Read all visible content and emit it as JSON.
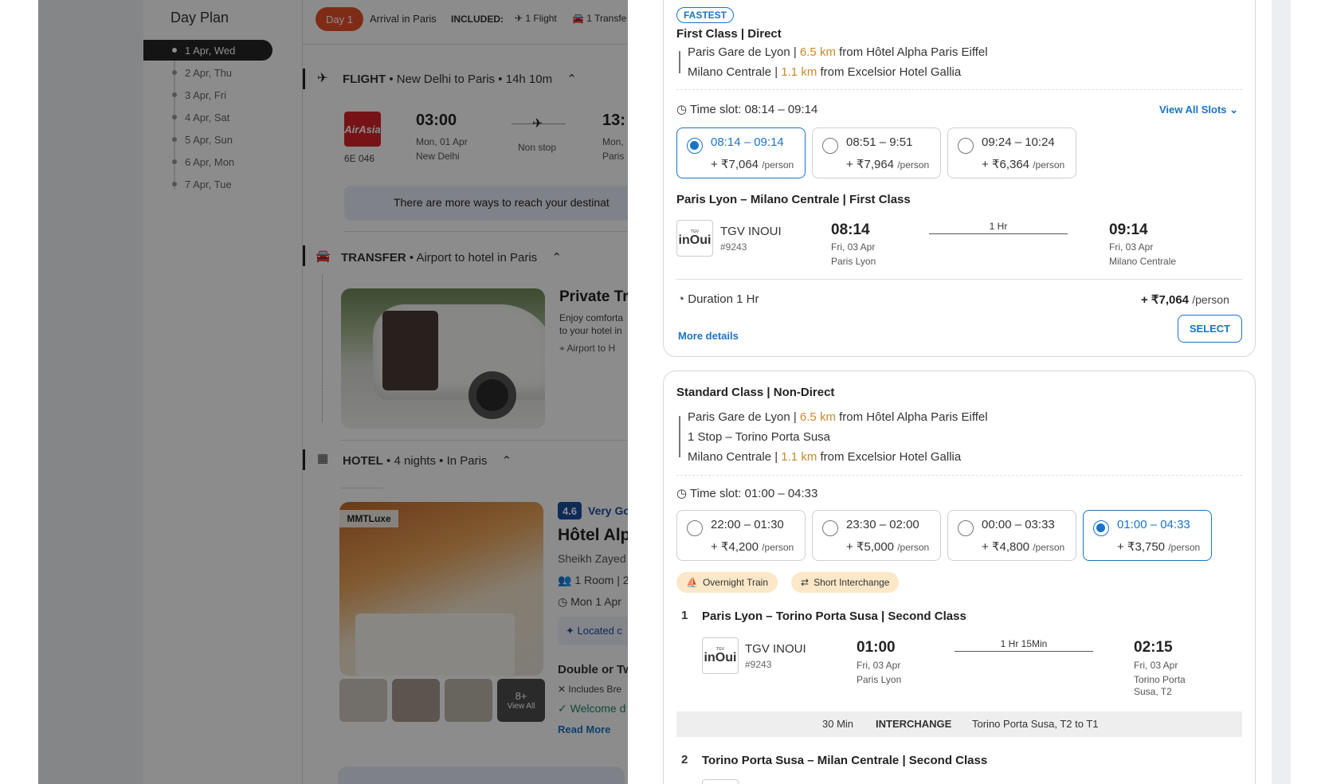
{
  "left": {
    "dayplan_title": "Day Plan",
    "days": [
      "1 Apr, Wed",
      "2 Apr, Thu",
      "3 Apr, Fri",
      "4 Apr, Sat",
      "5 Apr, Sun",
      "6 Apr, Mon",
      "7 Apr, Tue"
    ],
    "day_badge": "Day 1",
    "arrival": "Arrival in Paris",
    "included_label": "INCLUDED:",
    "included_flight": "1 Flight",
    "included_transfer": "1 Transfe",
    "flight": {
      "title": "FLIGHT",
      "route": "New Delhi to Paris",
      "duration": "14h 10m",
      "airline_logo": "AirAsia",
      "code": "6E 046",
      "dep_time": "03:00",
      "dep_date": "Mon, 01 Apr",
      "dep_city": "New Delhi",
      "stops": "Non stop",
      "arr_time": "13:",
      "arr_date": "Mon,",
      "arr_city": "Paris",
      "banner": "There are more ways to reach your destinat"
    },
    "transfer": {
      "title": "TRANSFER",
      "route": "Airport to hotel in Paris",
      "name": "Private Tra",
      "desc1": "Enjoy comforta",
      "desc2": "to your hotel in",
      "loc": "Airport to H"
    },
    "hotel": {
      "title": "HOTEL",
      "nights": "4 nights",
      "place": "In Paris",
      "badge": "MMTLuxe",
      "rating": "4.6",
      "rating_text": "Very Go",
      "name": "Hôtel Alp",
      "address": "Sheikh Zayed",
      "rooms": "1 Room | 2",
      "dates": "Mon 1 Apr",
      "located": "Located c",
      "room_type": "Double or Tw",
      "includes": "Includes Bre",
      "welcome": "Welcome d",
      "read_more": "Read More",
      "view_more_count": "8+",
      "view_all": "View All"
    }
  },
  "option1": {
    "badge": "FASTEST",
    "class": "First Class | Direct",
    "from_station": "Paris Gare de Lyon |",
    "from_dist": "6.5 km",
    "from_hotel": "from Hôtel Alpha Paris Eiffel",
    "to_station": "Milano Centrale |",
    "to_dist": "1.1 km",
    "to_hotel": "from Excelsior Hotel Gallia",
    "timeslot": "Time slot: 08:14 – 09:14",
    "view_all": "View All Slots",
    "slots": [
      {
        "time": "08:14 – 09:14",
        "price": "+ ₹7,064",
        "per": "/person"
      },
      {
        "time": "08:51 – 9:51",
        "price": "+ ₹7,964",
        "per": "/person"
      },
      {
        "time": "09:24 – 10:24",
        "price": "+ ₹6,364",
        "per": "/person"
      }
    ],
    "segment_title": "Paris Lyon – Milano Centrale | First Class",
    "train_name": "TGV INOUI",
    "train_no": "#9243",
    "dep_time": "08:14",
    "dep_date": "Fri, 03 Apr",
    "dep_station": "Paris Lyon",
    "duration_mid": "1 Hr",
    "arr_time": "09:14",
    "arr_date": "Fri, 03 Apr",
    "arr_station": "Milano Centrale",
    "duration": "Duration 1 Hr",
    "price": "+ ₹7,064",
    "per": "/person",
    "more": "More details",
    "select": "SELECT"
  },
  "option2": {
    "class": "Standard Class | Non-Direct",
    "from_station": "Paris Gare de Lyon |",
    "from_dist": "6.5 km",
    "from_hotel": "from Hôtel Alpha Paris Eiffel",
    "stop": "1 Stop – Torino Porta Susa",
    "to_station": "Milano Centrale |",
    "to_dist": "1.1 km",
    "to_hotel": "from Excelsior Hotel Gallia",
    "timeslot": "Time slot: 01:00 – 04:33",
    "slots": [
      {
        "time": "22:00 – 01:30",
        "price": "+ ₹4,200",
        "per": "/person"
      },
      {
        "time": "23:30 – 02:00",
        "price": "+ ₹5,000",
        "per": "/person"
      },
      {
        "time": "00:00 – 03:33",
        "price": "+ ₹4,800",
        "per": "/person"
      },
      {
        "time": "01:00 – 04:33",
        "price": "+ ₹3,750",
        "per": "/person"
      }
    ],
    "tag1": "Overnight Train",
    "tag2": "Short Interchange",
    "leg1_num": "1",
    "leg1_title": "Paris Lyon – Torino Porta Susa | Second Class",
    "train_name": "TGV INOUI",
    "train_no": "#9243",
    "dep_time": "01:00",
    "dep_date": "Fri, 03 Apr",
    "dep_station": "Paris Lyon",
    "duration_mid": "1 Hr 15Min",
    "arr_time": "02:15",
    "arr_date": "Fri, 03 Apr",
    "arr_station1": "Torino Porta",
    "arr_station2": "Susa, T2",
    "inter_time": "30 Min",
    "inter_label": "INTERCHANGE",
    "inter_place": "Torino Porta Susa, T2 to T1",
    "leg2_num": "2",
    "leg2_title": "Torino Porta Susa – Milan Centrale | Second Class"
  }
}
